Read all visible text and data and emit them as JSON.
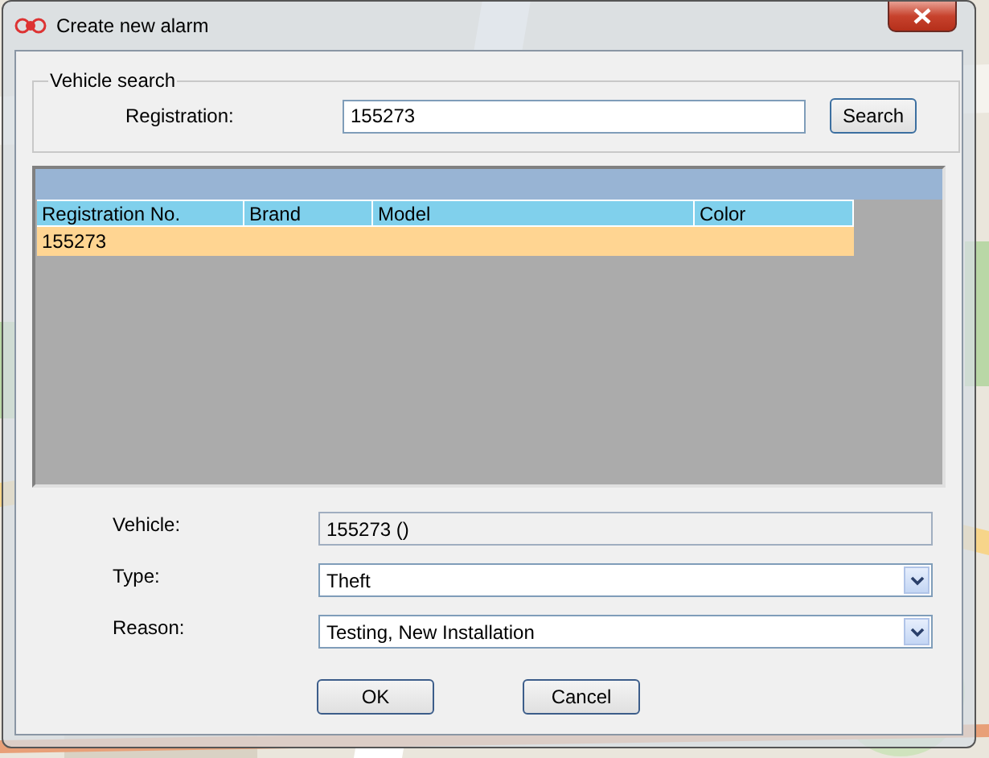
{
  "window": {
    "title": "Create new alarm"
  },
  "vehicle_search": {
    "legend": "Vehicle search",
    "label": "Registration:",
    "value": "155273",
    "button": "Search"
  },
  "table": {
    "columns": [
      "Registration No.",
      "Brand",
      "Model",
      "Color"
    ],
    "rows": [
      {
        "cells": [
          "155273",
          "",
          "",
          ""
        ],
        "selected": true
      }
    ]
  },
  "fields": [
    {
      "label": "Vehicle:",
      "value": "155273 ()",
      "kind": "readonly"
    },
    {
      "label": "Type:",
      "value": "Theft",
      "kind": "dropdown"
    },
    {
      "label": "Reason:",
      "value": "Testing, New Installation",
      "kind": "dropdown"
    }
  ],
  "buttons": [
    "OK",
    "Cancel"
  ]
}
